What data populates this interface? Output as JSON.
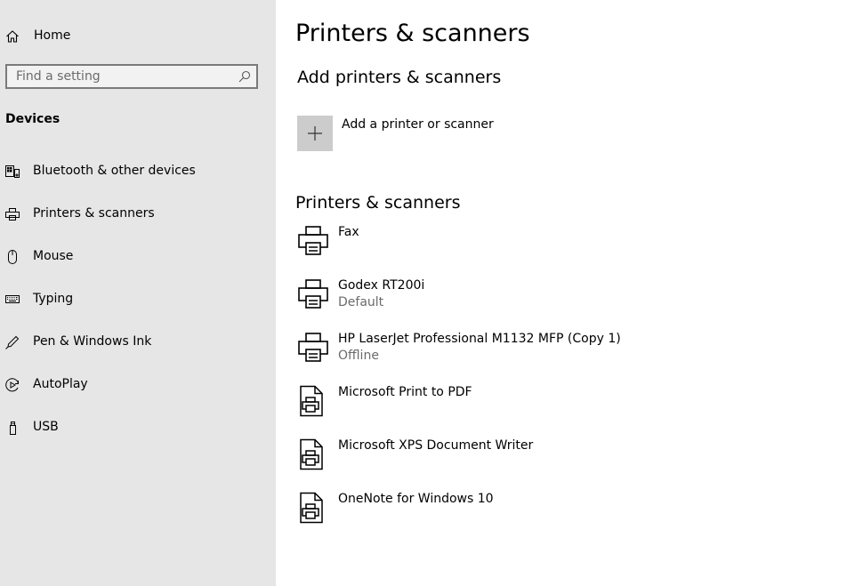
{
  "sidebar": {
    "home_label": "Home",
    "search_placeholder": "Find a setting",
    "section_title": "Devices",
    "items": [
      {
        "label": "Bluetooth & other devices",
        "icon": "bluetooth-devices-icon"
      },
      {
        "label": "Printers & scanners",
        "icon": "printer-icon"
      },
      {
        "label": "Mouse",
        "icon": "mouse-icon"
      },
      {
        "label": "Typing",
        "icon": "keyboard-icon"
      },
      {
        "label": "Pen & Windows Ink",
        "icon": "pen-icon"
      },
      {
        "label": "AutoPlay",
        "icon": "autoplay-icon"
      },
      {
        "label": "USB",
        "icon": "usb-icon"
      }
    ]
  },
  "main": {
    "title": "Printers & scanners",
    "add_section_title": "Add printers & scanners",
    "add_label": "Add a printer or scanner",
    "list_title": "Printers & scanners",
    "printers": [
      {
        "name": "Fax",
        "status": "",
        "icon": "printer-icon"
      },
      {
        "name": "Godex RT200i",
        "status": "Default",
        "icon": "printer-icon"
      },
      {
        "name": "HP LaserJet Professional M1132 MFP (Copy 1)",
        "status": "Offline",
        "icon": "printer-icon"
      },
      {
        "name": "Microsoft Print to PDF",
        "status": "",
        "icon": "document-printer-icon"
      },
      {
        "name": "Microsoft XPS Document Writer",
        "status": "",
        "icon": "document-printer-icon"
      },
      {
        "name": "OneNote for Windows 10",
        "status": "",
        "icon": "document-printer-icon"
      }
    ]
  },
  "colors": {
    "sidebar_bg": "#e6e6e6",
    "add_tile_bg": "#cccccc",
    "secondary_text": "#6b6b6b"
  }
}
